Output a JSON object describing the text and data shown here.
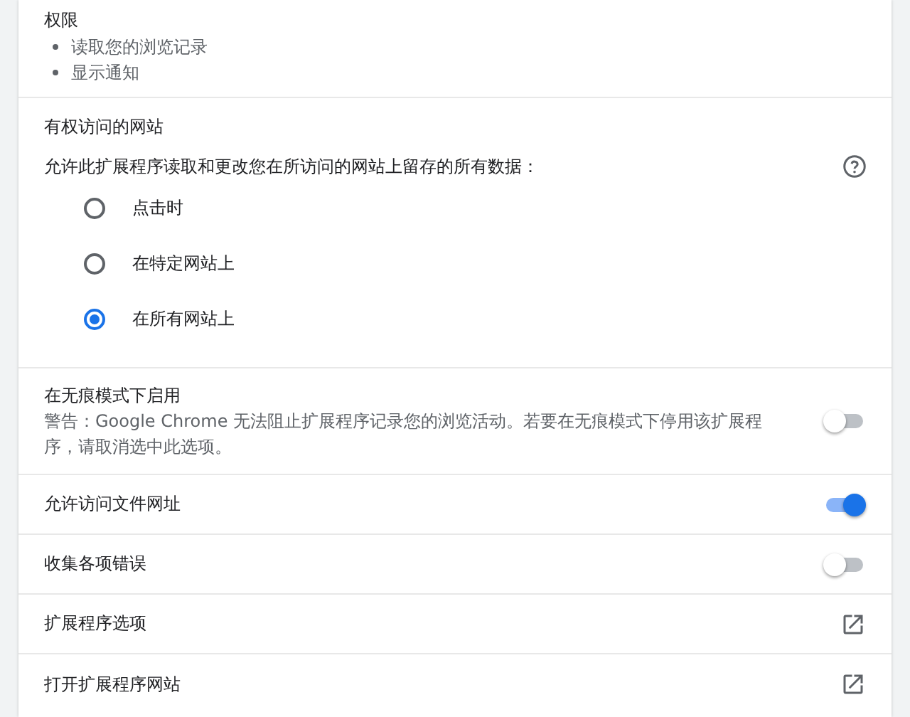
{
  "permissions": {
    "title": "权限",
    "items": [
      "读取您的浏览记录",
      "显示通知"
    ]
  },
  "site_access": {
    "title": "有权访问的网站",
    "description": "允许此扩展程序读取和更改您在所访问的网站上留存的所有数据：",
    "options": [
      {
        "label": "点击时",
        "selected": false
      },
      {
        "label": "在特定网站上",
        "selected": false
      },
      {
        "label": "在所有网站上",
        "selected": true
      }
    ]
  },
  "rows": [
    {
      "kind": "toggle",
      "label": "在无痕模式下启用",
      "description": "警告：Google Chrome 无法阻止扩展程序记录您的浏览活动。若要在无痕模式下停用该扩展程序，请取消选中此选项。",
      "on": false
    },
    {
      "kind": "toggle",
      "label": "允许访问文件网址",
      "on": true
    },
    {
      "kind": "toggle",
      "label": "收集各项错误",
      "on": false
    },
    {
      "kind": "link",
      "label": "扩展程序选项"
    },
    {
      "kind": "link",
      "label": "打开扩展程序网站"
    }
  ]
}
